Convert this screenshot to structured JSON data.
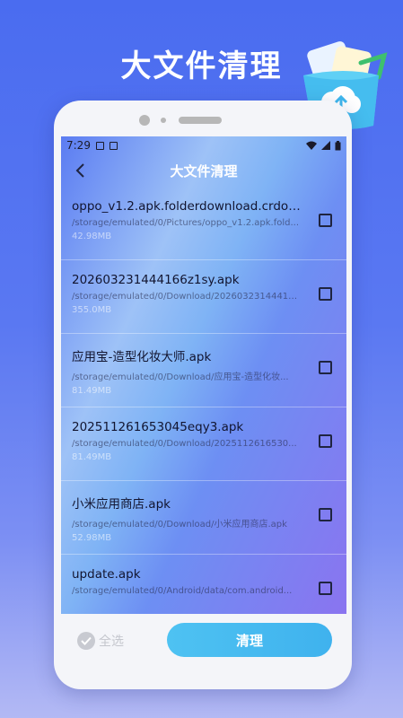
{
  "hero": {
    "title": "大文件清理"
  },
  "status": {
    "time": "7:29"
  },
  "toolbar": {
    "title": "大文件清理"
  },
  "files": [
    {
      "name": "oppo_v1.2.apk.folderdownload.crdow...",
      "path": "/storage/emulated/0/Pictures/oppo_v1.2.apk.fold...",
      "size": "42.98MB"
    },
    {
      "name": "202603231444166z1sy.apk",
      "path": "/storage/emulated/0/Download/20260323144416...",
      "size": "355.0MB"
    },
    {
      "name": "应用宝-造型化妆大师.apk",
      "path": "/storage/emulated/0/Download/应用宝-造型化妆...",
      "size": "81.49MB"
    },
    {
      "name": "202511261653045eqy3.apk",
      "path": "/storage/emulated/0/Download/2025112616530...",
      "size": "81.49MB"
    },
    {
      "name": "小米应用商店.apk",
      "path": "/storage/emulated/0/Download/小米应用商店.apk",
      "size": "52.98MB"
    },
    {
      "name": "update.apk",
      "path": "/storage/emulated/0/Android/data/com.android...",
      "size": ""
    }
  ],
  "bottom": {
    "select_all": "全选",
    "clean": "清理"
  },
  "colors": {
    "accent": "#45b9f0",
    "background": "#4a6cf0"
  }
}
